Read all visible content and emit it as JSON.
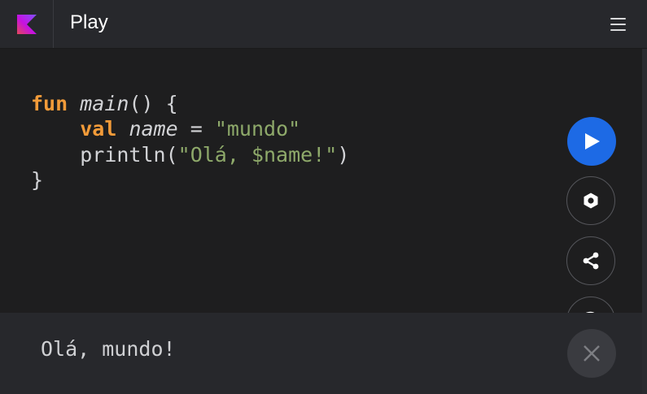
{
  "header": {
    "logo_icon": "kotlin-logo-icon",
    "title": "Play",
    "menu_icon": "hamburger-menu-icon"
  },
  "editor": {
    "line1": {
      "keyword": "fun",
      "fn_name": "main",
      "rest": "() {"
    },
    "line2": {
      "indent": "    ",
      "keyword": "val",
      "var_name": "name",
      "op": " = ",
      "string": "\"mundo\""
    },
    "line3": {
      "indent": "    ",
      "call": "println(",
      "string": "\"Olá, $name!\"",
      "close": ")"
    },
    "line4": {
      "text": "}"
    }
  },
  "actions": {
    "run_icon": "play-icon",
    "hexagon_icon": "hexagon-icon",
    "share_icon": "share-icon",
    "help_label": "?"
  },
  "output": {
    "text": "Olá, mundo!",
    "close_icon": "close-icon"
  },
  "colors": {
    "accent": "#1d6ae5",
    "keyword": "#f29b39",
    "string": "#8ea96a",
    "background": "#1e1e1f",
    "header_bg": "#27282c"
  }
}
